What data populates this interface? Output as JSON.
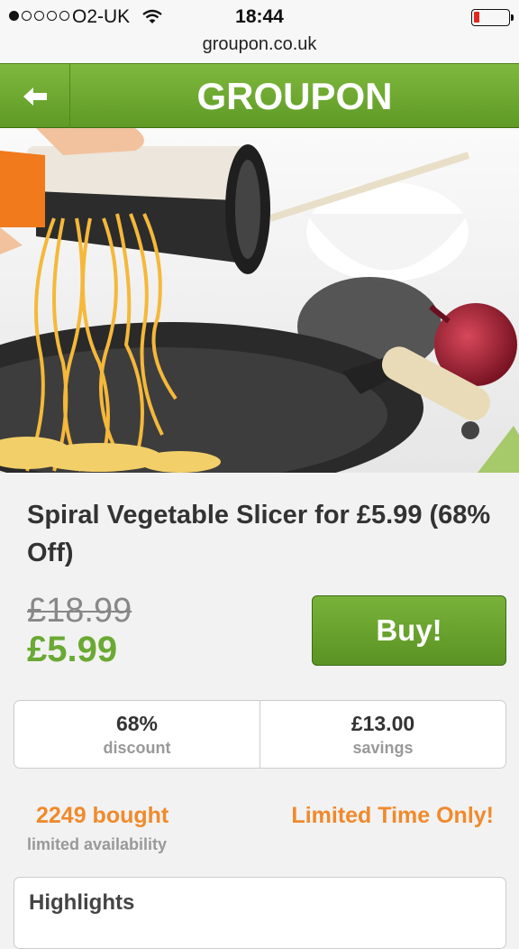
{
  "status_bar": {
    "carrier": "O2-UK",
    "time": "18:44",
    "signal_bars": 1,
    "battery_level": 0.1,
    "battery_color": "#e0281e"
  },
  "browser": {
    "url": "groupon.co.uk"
  },
  "header": {
    "brand": "GROUPON",
    "back_icon": "arrow-left-icon",
    "color": "#6aa933"
  },
  "deal": {
    "title": "Spiral Vegetable Slicer for £5.99 (68% Off)",
    "original_price": "£18.99",
    "price": "£5.99",
    "buy_label": "Buy!",
    "discount_value": "68%",
    "discount_label": "discount",
    "savings_value": "£13.00",
    "savings_label": "savings",
    "bought": "2249 bought",
    "availability": "limited availability",
    "limited_time": "Limited Time Only!",
    "highlights_title": "Highlights",
    "accent_color": "#f08a2c"
  }
}
